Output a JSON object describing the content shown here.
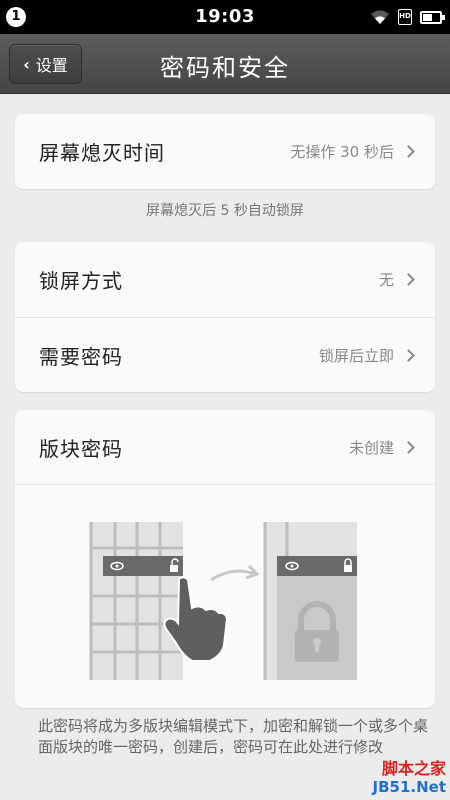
{
  "status_bar": {
    "notification_count": "1",
    "time": "19:03",
    "icons": [
      "wifi-icon",
      "hd-sim-icon",
      "battery-icon"
    ]
  },
  "header": {
    "back_label": "设置",
    "title": "密码和安全"
  },
  "screen_timeout": {
    "label": "屏幕熄灭时间",
    "value": "无操作 30 秒后",
    "hint": "屏幕熄灭后 5 秒自动锁屏"
  },
  "lock": {
    "method_label": "锁屏方式",
    "method_value": "无",
    "require_label": "需要密码",
    "require_value": "锁屏后立即"
  },
  "panel_password": {
    "label": "版块密码",
    "value": "未创建",
    "description": "此密码将成为多版块编辑模式下，加密和解锁一个或多个桌面版块的唯一密码，创建后，密码可在此处进行修改"
  },
  "watermark": {
    "line1": "脚本之家",
    "line2": "JB51.Net"
  },
  "colors": {
    "titlebar": "#4d4d4d",
    "background": "#ececec",
    "card": "#fafafa"
  }
}
